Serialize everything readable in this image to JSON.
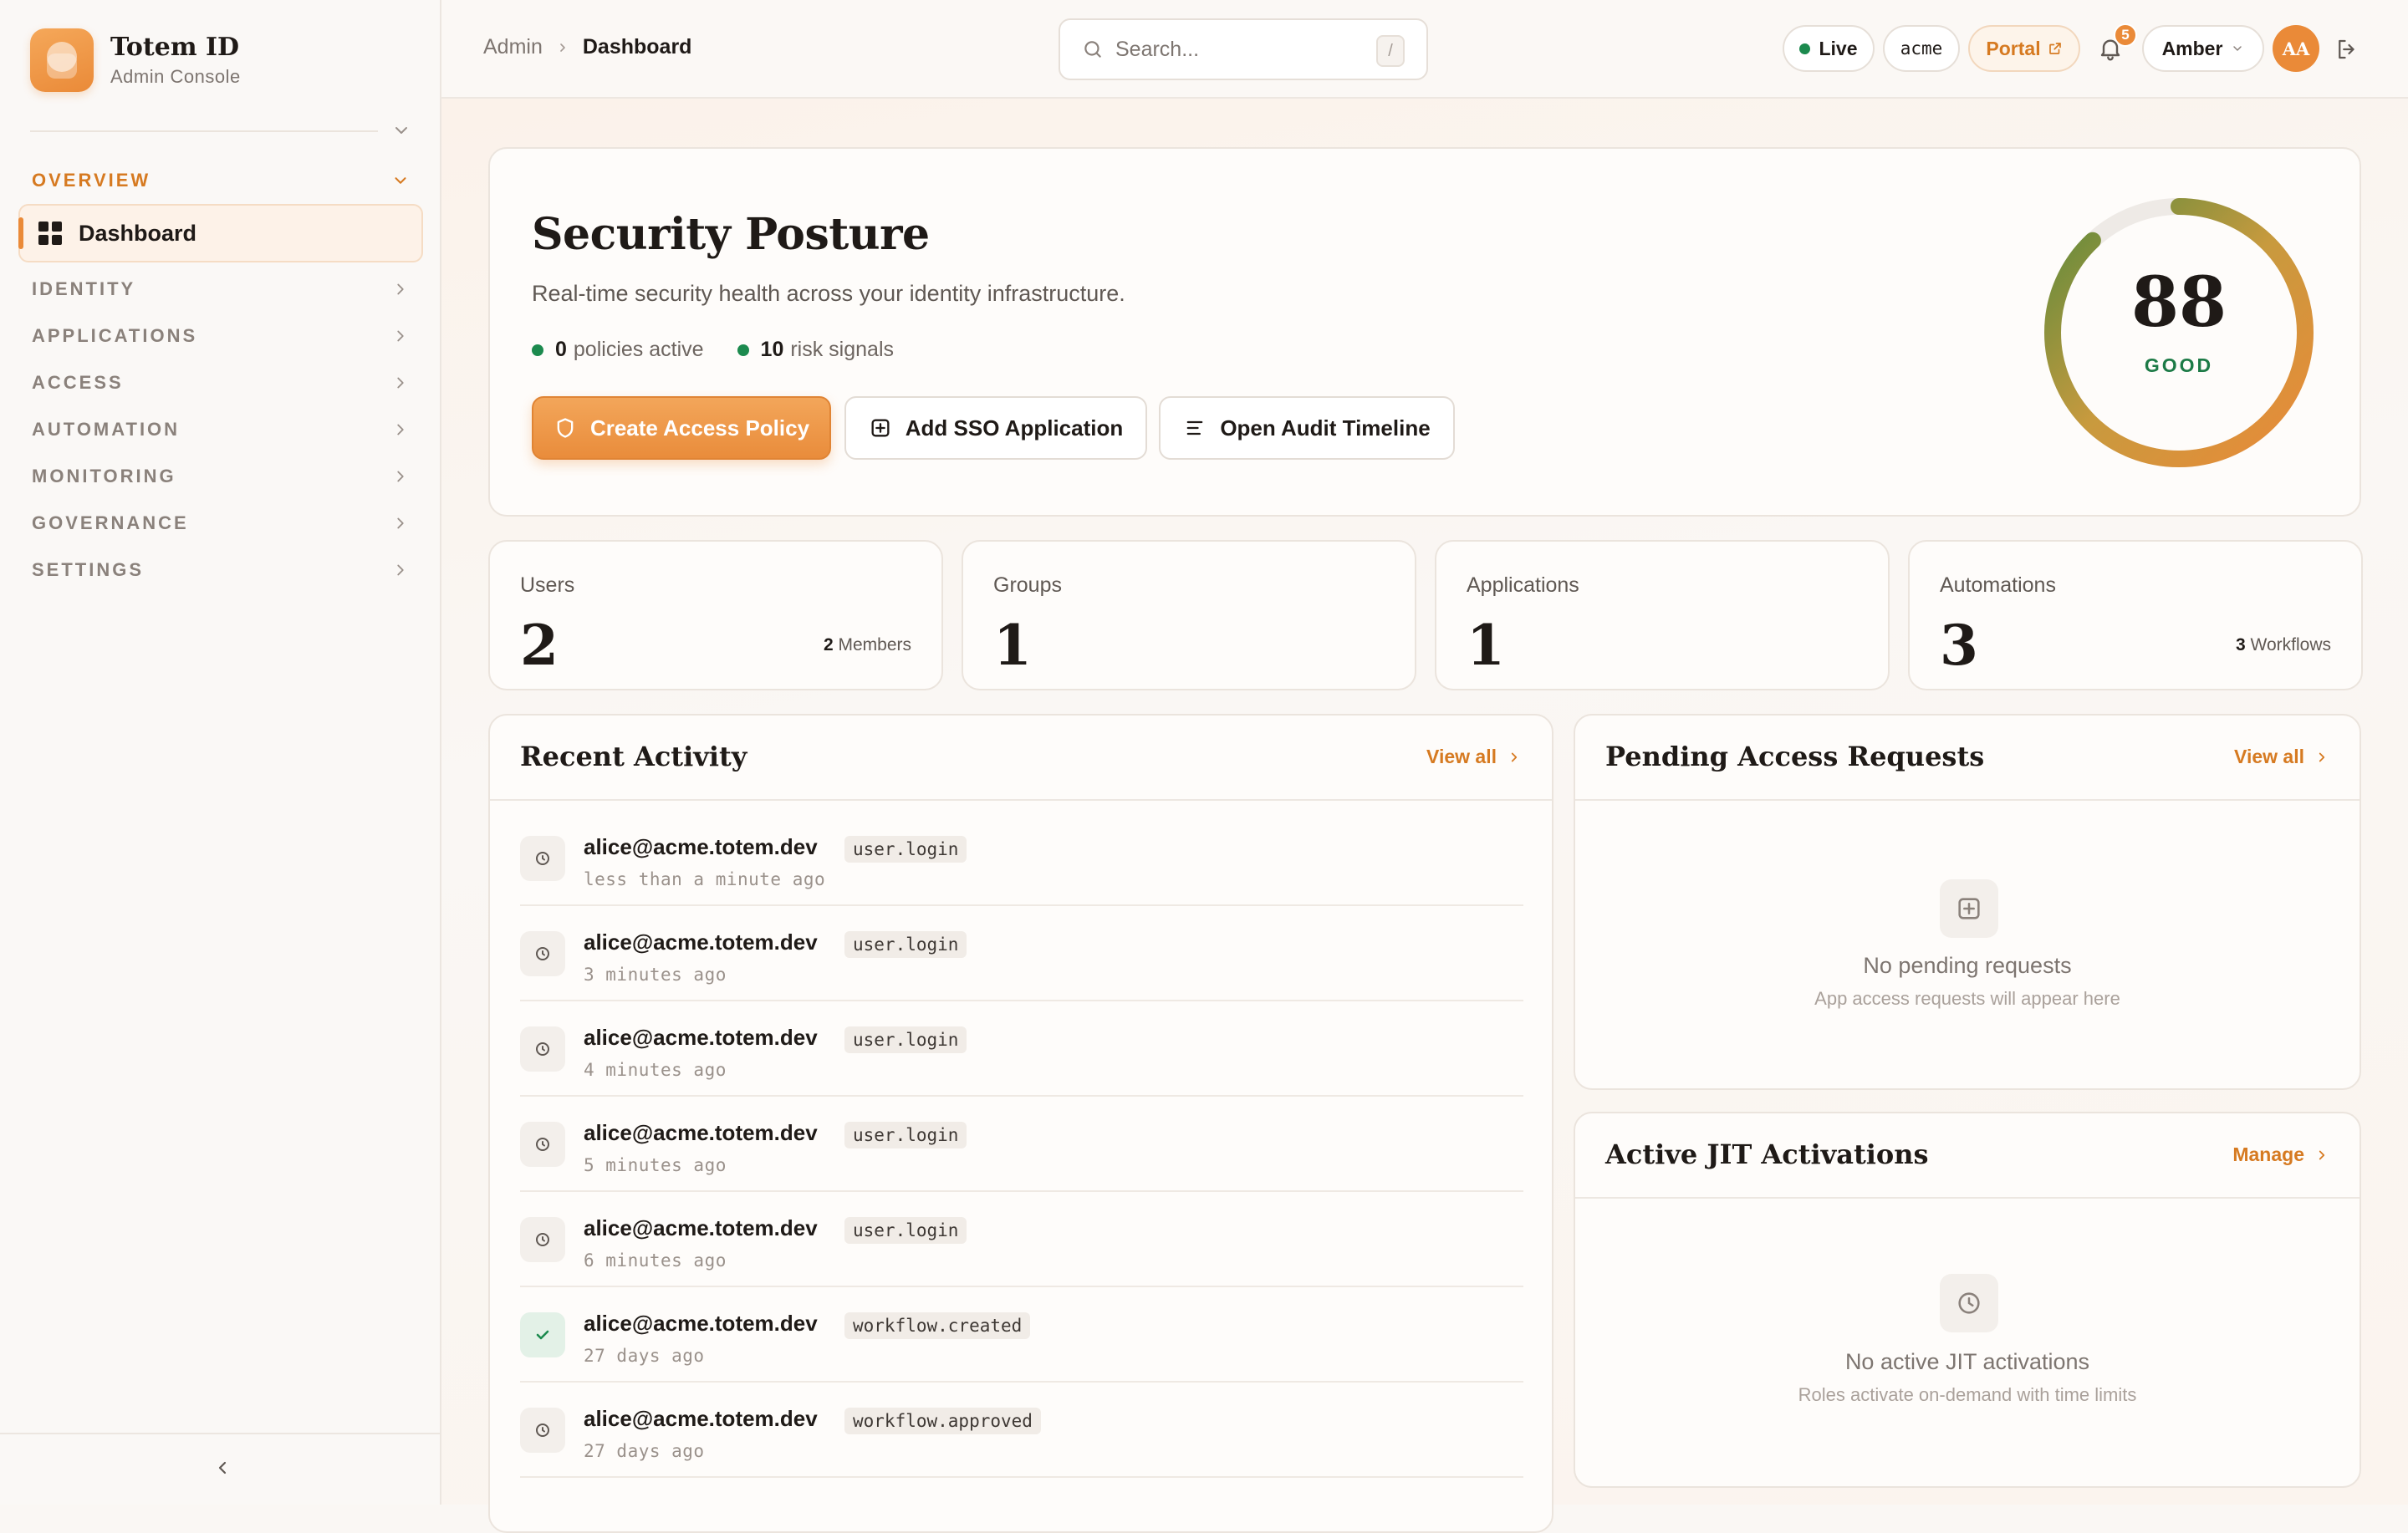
{
  "brand": {
    "name": "Totem ID",
    "subtitle": "Admin Console"
  },
  "sidebar": {
    "sections": [
      {
        "label": "OVERVIEW",
        "expanded": true,
        "active": true
      },
      {
        "label": "IDENTITY"
      },
      {
        "label": "APPLICATIONS"
      },
      {
        "label": "ACCESS"
      },
      {
        "label": "AUTOMATION"
      },
      {
        "label": "MONITORING"
      },
      {
        "label": "GOVERNANCE"
      },
      {
        "label": "SETTINGS"
      }
    ],
    "active_item": {
      "label": "Dashboard",
      "icon": "dashboard-grid-icon"
    }
  },
  "topbar": {
    "breadcrumb": [
      "Admin",
      "Dashboard"
    ],
    "search_placeholder": "Search...",
    "search_shortcut": "/",
    "live_label": "Live",
    "org_label": "acme",
    "portal_label": "Portal",
    "notification_count": "5",
    "user_name": "Amber",
    "avatar_initials": "AA"
  },
  "hero": {
    "title": "Security Posture",
    "subtitle": "Real-time security health across your identity infrastructure.",
    "policies_count": "0",
    "policies_label": "policies active",
    "risk_count": "10",
    "risk_label": "risk signals",
    "buttons": {
      "create_policy": "Create Access Policy",
      "add_sso": "Add SSO Application",
      "audit": "Open Audit Timeline"
    },
    "score": {
      "value": 88,
      "max": 100,
      "label": "GOOD"
    }
  },
  "kpis": [
    {
      "label": "Users",
      "value": "2",
      "note_num": "2",
      "note_text": "Members"
    },
    {
      "label": "Groups",
      "value": "1",
      "note_num": "",
      "note_text": ""
    },
    {
      "label": "Applications",
      "value": "1",
      "note_num": "",
      "note_text": ""
    },
    {
      "label": "Automations",
      "value": "3",
      "note_num": "3",
      "note_text": "Workflows"
    }
  ],
  "activity": {
    "title": "Recent Activity",
    "link": "View all",
    "rows": [
      {
        "user": "alice@acme.totem.dev",
        "event": "user.login",
        "time": "less than a minute ago",
        "icon": "clock-icon"
      },
      {
        "user": "alice@acme.totem.dev",
        "event": "user.login",
        "time": "3 minutes ago",
        "icon": "clock-icon"
      },
      {
        "user": "alice@acme.totem.dev",
        "event": "user.login",
        "time": "4 minutes ago",
        "icon": "clock-icon"
      },
      {
        "user": "alice@acme.totem.dev",
        "event": "user.login",
        "time": "5 minutes ago",
        "icon": "clock-icon"
      },
      {
        "user": "alice@acme.totem.dev",
        "event": "user.login",
        "time": "6 minutes ago",
        "icon": "clock-icon"
      },
      {
        "user": "alice@acme.totem.dev",
        "event": "workflow.created",
        "time": "27 days ago",
        "icon": "check-icon"
      },
      {
        "user": "alice@acme.totem.dev",
        "event": "workflow.approved",
        "time": "27 days ago",
        "icon": "clock-icon"
      }
    ]
  },
  "pending": {
    "title": "Pending Access Requests",
    "link": "View all",
    "empty_title": "No pending requests",
    "empty_sub": "App access requests will appear here"
  },
  "jit": {
    "title": "Active JIT Activations",
    "link": "Manage",
    "empty_title": "No active JIT activations",
    "empty_sub": "Roles activate on-demand with time limits"
  },
  "colors": {
    "accent": "#ea8a38",
    "success": "#1c8a4e",
    "gauge_start": "#ea8a38",
    "gauge_end": "#5a8a3c"
  }
}
